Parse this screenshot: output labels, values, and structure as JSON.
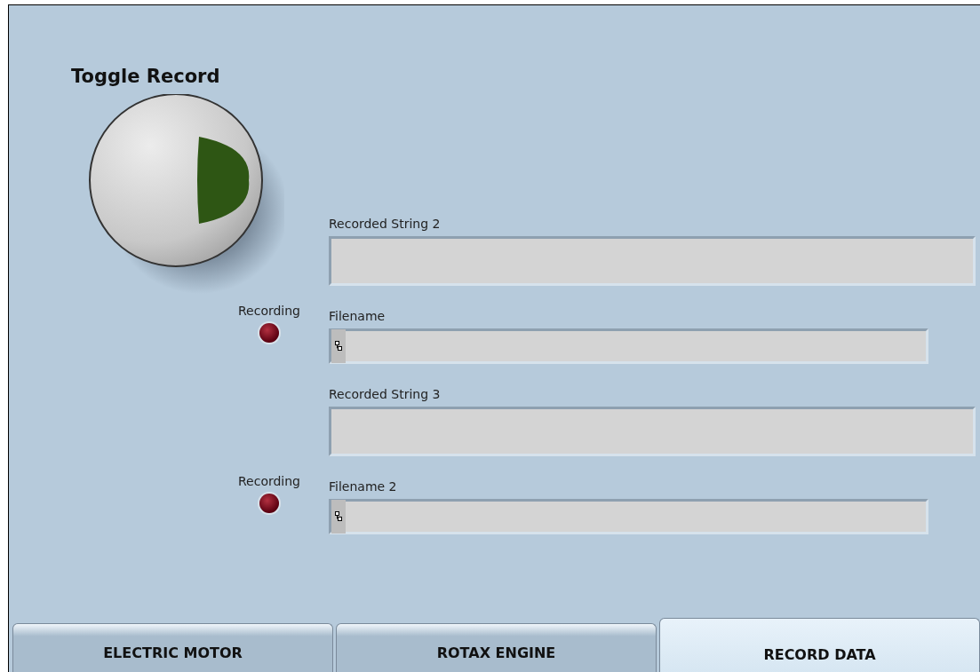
{
  "toggle": {
    "label": "Toggle Record"
  },
  "rows": [
    {
      "indicator": null,
      "field": {
        "kind": "string",
        "label": "Recorded String 2"
      }
    },
    {
      "indicator": {
        "label": "Recording",
        "on": false
      },
      "field": {
        "kind": "path",
        "label": "Filename"
      }
    },
    {
      "indicator": null,
      "field": {
        "kind": "string",
        "label": "Recorded String 3"
      }
    },
    {
      "indicator": {
        "label": "Recording",
        "on": false
      },
      "field": {
        "kind": "path",
        "label": "Filename 2"
      }
    }
  ],
  "tabs": [
    {
      "label": "ELECTRIC MOTOR",
      "selected": false
    },
    {
      "label": "ROTAX ENGINE",
      "selected": false
    },
    {
      "label": "RECORD DATA",
      "selected": true
    }
  ]
}
